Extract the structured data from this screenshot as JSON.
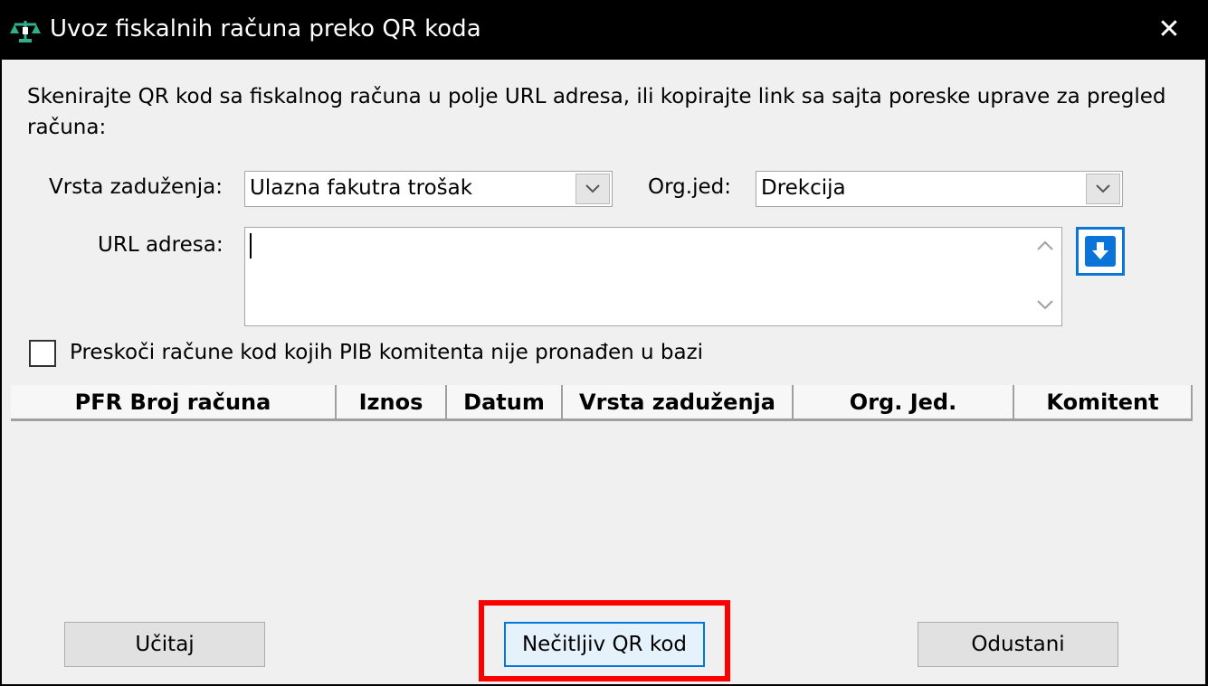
{
  "window": {
    "title": "Uvoz fiskalnih računa preko QR koda",
    "app_icon": "scales-icon",
    "close_label": "✕"
  },
  "form": {
    "instructions": "Skenirajte QR kod sa fiskalnog računa u polje URL adresa, ili kopirajte link sa sajta poreske uprave za pregled računa:",
    "vrsta_label": "Vrsta zaduženja:",
    "vrsta_value": "Ulazna fakutra trošak",
    "orgjed_label": "Org.jed:",
    "orgjed_value": "Drekcija",
    "url_label": "URL adresa:",
    "url_value": "",
    "skip_label": "Preskoči račune kod kojih PIB komitenta nije pronađen u bazi",
    "skip_checked": false
  },
  "grid": {
    "columns": [
      "PFR Broj računa",
      "Iznos",
      "Datum",
      "Vrsta zaduženja",
      "Org. Jed.",
      "Komitent"
    ]
  },
  "buttons": {
    "load": "Učitaj",
    "unreadable": "Nečitljiv QR kod",
    "cancel": "Odustani"
  },
  "colors": {
    "highlight": "#ff0000",
    "accent": "#0b74d9",
    "icon_green": "#1f9c7a"
  }
}
